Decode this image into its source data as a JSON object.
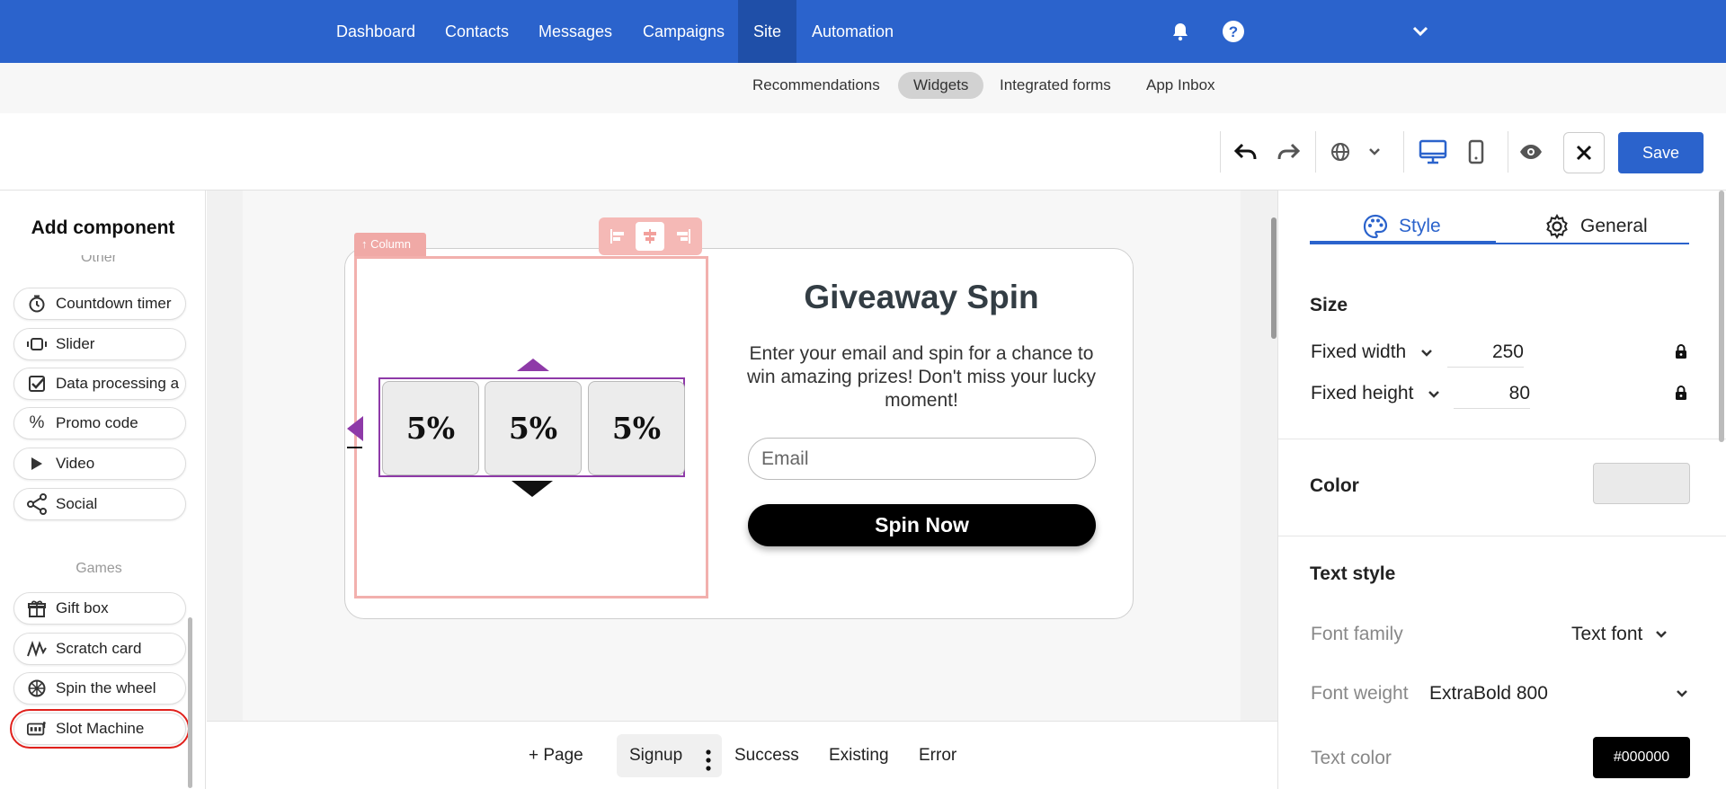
{
  "topnav": {
    "items": [
      "Dashboard",
      "Contacts",
      "Messages",
      "Campaigns",
      "Site",
      "Automation"
    ],
    "active": "Site",
    "icons": [
      "bell-icon",
      "help-icon",
      "chevron-down-icon"
    ]
  },
  "subnav": {
    "items": [
      "Recommendations",
      "Widgets",
      "Integrated forms",
      "App Inbox"
    ],
    "active": "Widgets"
  },
  "toolbar": {
    "icons": [
      "undo-icon",
      "redo-icon",
      "globe-icon",
      "chevron-down-icon",
      "desktop-icon",
      "mobile-icon",
      "preview-icon",
      "close-icon"
    ],
    "save_label": "Save"
  },
  "left_panel": {
    "title": "Add component",
    "section_other": "Other",
    "other_items": [
      {
        "label": "Countdown timer",
        "icon": "timer-icon"
      },
      {
        "label": "Slider",
        "icon": "slider-icon"
      },
      {
        "label": "Data processing a",
        "icon": "checkbox-icon"
      },
      {
        "label": "Promo code",
        "icon": "percent-icon"
      },
      {
        "label": "Video",
        "icon": "play-icon"
      },
      {
        "label": "Social",
        "icon": "share-icon"
      }
    ],
    "section_games": "Games",
    "games_items": [
      {
        "label": "Gift box",
        "icon": "gift-icon"
      },
      {
        "label": "Scratch card",
        "icon": "scratch-icon"
      },
      {
        "label": "Spin the wheel",
        "icon": "wheel-icon"
      },
      {
        "label": "Slot Machine",
        "icon": "slot-machine-icon"
      }
    ],
    "selected": "Slot Machine",
    "selected_color": "#e0201b"
  },
  "canvas": {
    "column_tag": "Column",
    "reels": [
      "5%",
      "5%",
      "5%"
    ],
    "accent": "#8e3aa8",
    "title": "Giveaway Spin",
    "description": "Enter your email and spin for a chance to win amazing prizes! Don't miss your lucky moment!",
    "email_placeholder": "Email",
    "button_label": "Spin Now"
  },
  "pagebar": {
    "add_page": "+ Page",
    "tabs": [
      "Signup",
      "Success",
      "Existing",
      "Error"
    ],
    "active": "Signup"
  },
  "right_panel": {
    "tabs": [
      "Style",
      "General"
    ],
    "active_tab": "Style",
    "size_heading": "Size",
    "width_label": "Fixed width",
    "width_value": "250",
    "height_label": "Fixed height",
    "height_value": "80",
    "color_heading": "Color",
    "color_value": "#eaeaea",
    "text_style_heading": "Text style",
    "font_family_label": "Font family",
    "font_family_value": "Text font",
    "font_weight_label": "Font weight",
    "font_weight_value": "ExtraBold 800",
    "text_color_label": "Text color",
    "text_color_value": "#000000"
  },
  "colors": {
    "brand": "#2b63cc",
    "selection": "#f2b0ad"
  }
}
